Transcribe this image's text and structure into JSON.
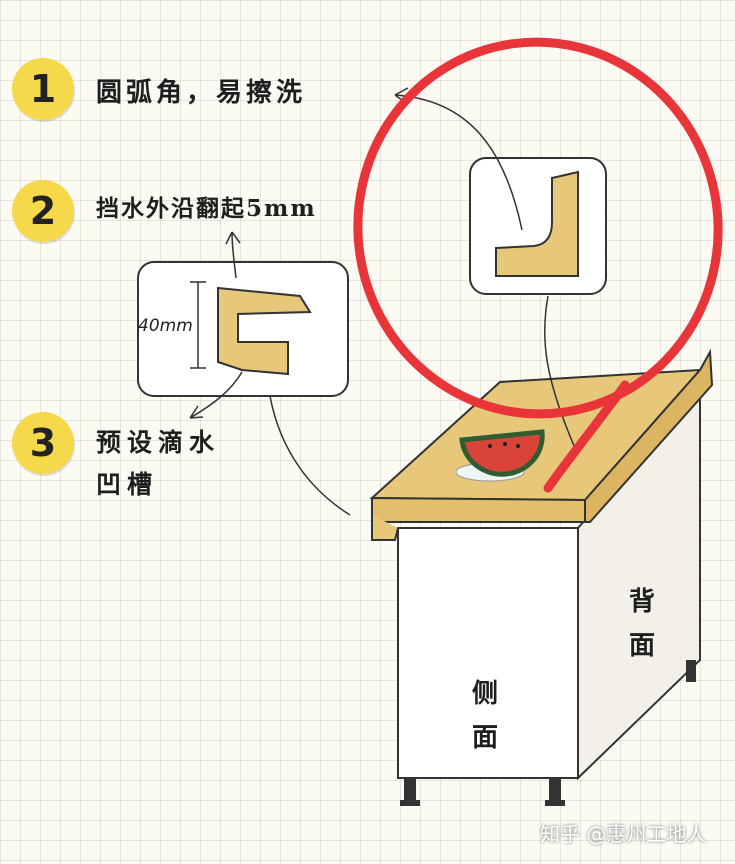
{
  "callouts": [
    {
      "number": "1",
      "text": "圆弧角，易擦洗"
    },
    {
      "number": "2",
      "text": "挡水外沿翻起5mm"
    },
    {
      "number": "3",
      "text": "预设滴水\n凹槽"
    }
  ],
  "dimension": "40mm",
  "cabinet": {
    "side_label": "侧\n面",
    "back_label": "背\n面"
  },
  "watermark": "知乎 @惠州工地人",
  "colors": {
    "highlight": "#e8353a",
    "countertop": "#e7c77a",
    "badge": "#f5d94a"
  }
}
